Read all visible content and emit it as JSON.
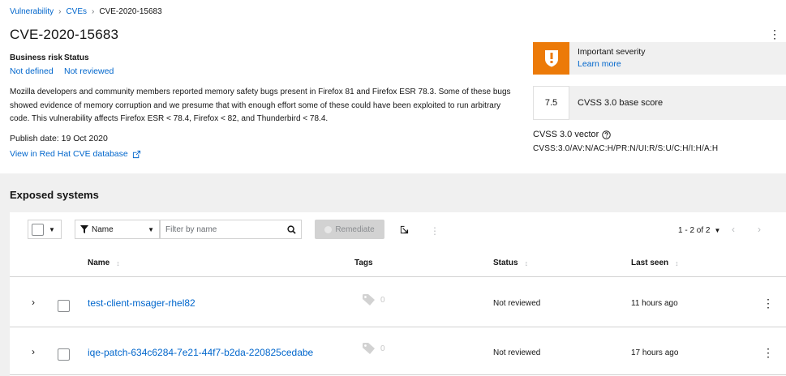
{
  "breadcrumb": {
    "items": [
      "Vulnerability",
      "CVEs"
    ],
    "current": "CVE-2020-15683"
  },
  "page_title": "CVE-2020-15683",
  "business_risk": {
    "label": "Business risk",
    "value": "Not defined"
  },
  "status": {
    "label": "Status",
    "value": "Not reviewed"
  },
  "description": "Mozilla developers and community members reported memory safety bugs present in Firefox 81 and Firefox ESR 78.3. Some of these bugs showed evidence of memory corruption and we presume that with enough effort some of these could have been exploited to run arbitrary code. This vulnerability affects Firefox ESR < 78.4, Firefox < 82, and Thunderbird < 78.4.",
  "publish_date": "Publish date: 19 Oct 2020",
  "redhat_link": "View in Red Hat CVE database",
  "severity": {
    "title": "Important severity",
    "learn_more": "Learn more",
    "color": "#ec7a08"
  },
  "cvss": {
    "score": "7.5",
    "score_label": "CVSS 3.0 base score",
    "vector_title": "CVSS 3.0 vector",
    "vector_value": "CVSS:3.0/AV:N/AC:H/PR:N/UI:R/S:U/C:H/I:H/A:H"
  },
  "exposed": {
    "title": "Exposed systems",
    "filter_attribute": "Name",
    "filter_placeholder": "Filter by name",
    "remediate_label": "Remediate",
    "pagination": "1 - 2 of 2",
    "columns": {
      "name": "Name",
      "tags": "Tags",
      "status": "Status",
      "last_seen": "Last seen"
    },
    "rows": [
      {
        "name": "test-client-msager-rhel82",
        "tags": "0",
        "status": "Not reviewed",
        "last_seen": "11 hours ago"
      },
      {
        "name": "iqe-patch-634c6284-7e21-44f7-b2da-220825cedabe",
        "tags": "0",
        "status": "Not reviewed",
        "last_seen": "17 hours ago"
      }
    ]
  },
  "colors": {
    "link": "#0066cc",
    "section_bg": "#f0f0f0",
    "severity_important": "#ec7a08"
  },
  "icons": [
    "kebab-icon",
    "exclamation-shield-icon",
    "help-icon",
    "external-link-icon",
    "filter-icon",
    "search-icon",
    "export-icon",
    "chevron-right-icon",
    "chevron-left-icon",
    "tag-icon"
  ]
}
